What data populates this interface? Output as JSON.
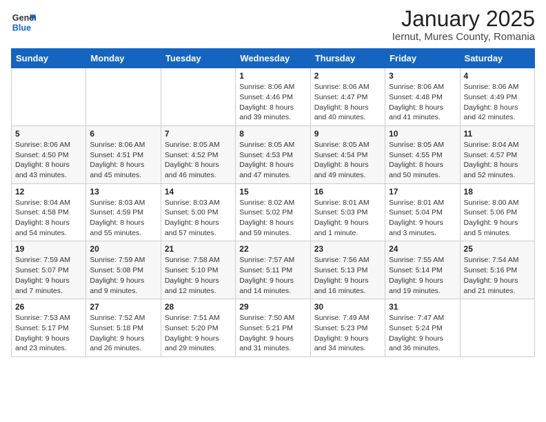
{
  "header": {
    "logo_general": "General",
    "logo_blue": "Blue",
    "title": "January 2025",
    "subtitle": "Iernut, Mures County, Romania"
  },
  "weekdays": [
    "Sunday",
    "Monday",
    "Tuesday",
    "Wednesday",
    "Thursday",
    "Friday",
    "Saturday"
  ],
  "weeks": [
    [
      {
        "day": "",
        "info": ""
      },
      {
        "day": "",
        "info": ""
      },
      {
        "day": "",
        "info": ""
      },
      {
        "day": "1",
        "info": "Sunrise: 8:06 AM\nSunset: 4:46 PM\nDaylight: 8 hours\nand 39 minutes."
      },
      {
        "day": "2",
        "info": "Sunrise: 8:06 AM\nSunset: 4:47 PM\nDaylight: 8 hours\nand 40 minutes."
      },
      {
        "day": "3",
        "info": "Sunrise: 8:06 AM\nSunset: 4:48 PM\nDaylight: 8 hours\nand 41 minutes."
      },
      {
        "day": "4",
        "info": "Sunrise: 8:06 AM\nSunset: 4:49 PM\nDaylight: 8 hours\nand 42 minutes."
      }
    ],
    [
      {
        "day": "5",
        "info": "Sunrise: 8:06 AM\nSunset: 4:50 PM\nDaylight: 8 hours\nand 43 minutes."
      },
      {
        "day": "6",
        "info": "Sunrise: 8:06 AM\nSunset: 4:51 PM\nDaylight: 8 hours\nand 45 minutes."
      },
      {
        "day": "7",
        "info": "Sunrise: 8:05 AM\nSunset: 4:52 PM\nDaylight: 8 hours\nand 46 minutes."
      },
      {
        "day": "8",
        "info": "Sunrise: 8:05 AM\nSunset: 4:53 PM\nDaylight: 8 hours\nand 47 minutes."
      },
      {
        "day": "9",
        "info": "Sunrise: 8:05 AM\nSunset: 4:54 PM\nDaylight: 8 hours\nand 49 minutes."
      },
      {
        "day": "10",
        "info": "Sunrise: 8:05 AM\nSunset: 4:55 PM\nDaylight: 8 hours\nand 50 minutes."
      },
      {
        "day": "11",
        "info": "Sunrise: 8:04 AM\nSunset: 4:57 PM\nDaylight: 8 hours\nand 52 minutes."
      }
    ],
    [
      {
        "day": "12",
        "info": "Sunrise: 8:04 AM\nSunset: 4:58 PM\nDaylight: 8 hours\nand 54 minutes."
      },
      {
        "day": "13",
        "info": "Sunrise: 8:03 AM\nSunset: 4:59 PM\nDaylight: 8 hours\nand 55 minutes."
      },
      {
        "day": "14",
        "info": "Sunrise: 8:03 AM\nSunset: 5:00 PM\nDaylight: 8 hours\nand 57 minutes."
      },
      {
        "day": "15",
        "info": "Sunrise: 8:02 AM\nSunset: 5:02 PM\nDaylight: 8 hours\nand 59 minutes."
      },
      {
        "day": "16",
        "info": "Sunrise: 8:01 AM\nSunset: 5:03 PM\nDaylight: 9 hours\nand 1 minute."
      },
      {
        "day": "17",
        "info": "Sunrise: 8:01 AM\nSunset: 5:04 PM\nDaylight: 9 hours\nand 3 minutes."
      },
      {
        "day": "18",
        "info": "Sunrise: 8:00 AM\nSunset: 5:06 PM\nDaylight: 9 hours\nand 5 minutes."
      }
    ],
    [
      {
        "day": "19",
        "info": "Sunrise: 7:59 AM\nSunset: 5:07 PM\nDaylight: 9 hours\nand 7 minutes."
      },
      {
        "day": "20",
        "info": "Sunrise: 7:59 AM\nSunset: 5:08 PM\nDaylight: 9 hours\nand 9 minutes."
      },
      {
        "day": "21",
        "info": "Sunrise: 7:58 AM\nSunset: 5:10 PM\nDaylight: 9 hours\nand 12 minutes."
      },
      {
        "day": "22",
        "info": "Sunrise: 7:57 AM\nSunset: 5:11 PM\nDaylight: 9 hours\nand 14 minutes."
      },
      {
        "day": "23",
        "info": "Sunrise: 7:56 AM\nSunset: 5:13 PM\nDaylight: 9 hours\nand 16 minutes."
      },
      {
        "day": "24",
        "info": "Sunrise: 7:55 AM\nSunset: 5:14 PM\nDaylight: 9 hours\nand 19 minutes."
      },
      {
        "day": "25",
        "info": "Sunrise: 7:54 AM\nSunset: 5:16 PM\nDaylight: 9 hours\nand 21 minutes."
      }
    ],
    [
      {
        "day": "26",
        "info": "Sunrise: 7:53 AM\nSunset: 5:17 PM\nDaylight: 9 hours\nand 23 minutes."
      },
      {
        "day": "27",
        "info": "Sunrise: 7:52 AM\nSunset: 5:18 PM\nDaylight: 9 hours\nand 26 minutes."
      },
      {
        "day": "28",
        "info": "Sunrise: 7:51 AM\nSunset: 5:20 PM\nDaylight: 9 hours\nand 29 minutes."
      },
      {
        "day": "29",
        "info": "Sunrise: 7:50 AM\nSunset: 5:21 PM\nDaylight: 9 hours\nand 31 minutes."
      },
      {
        "day": "30",
        "info": "Sunrise: 7:49 AM\nSunset: 5:23 PM\nDaylight: 9 hours\nand 34 minutes."
      },
      {
        "day": "31",
        "info": "Sunrise: 7:47 AM\nSunset: 5:24 PM\nDaylight: 9 hours\nand 36 minutes."
      },
      {
        "day": "",
        "info": ""
      }
    ]
  ]
}
